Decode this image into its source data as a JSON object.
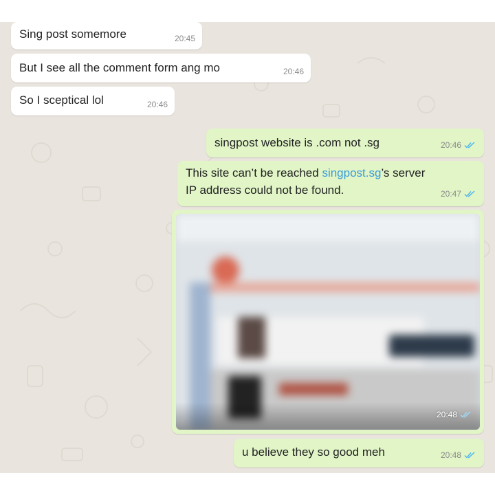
{
  "messages": {
    "m1": {
      "text": "Sing post somemore",
      "time": "20:45"
    },
    "m2": {
      "text": "But I see all the comment form ang mo",
      "time": "20:46"
    },
    "m3": {
      "text": "So I sceptical lol",
      "time": "20:46"
    },
    "m4": {
      "text": "singpost website is .com not .sg",
      "time": "20:46"
    },
    "m5": {
      "text_before": "This site can’t be reached ",
      "link": "singpost.sg",
      "text_after": "’s server",
      "line2": "IP address could not be found.",
      "time": "20:47"
    },
    "m6": {
      "time": "20:48"
    },
    "m7": {
      "text": "u believe they so good meh",
      "time": "20:48"
    }
  },
  "colors": {
    "chat_bg": "#e9e4dd",
    "incoming": "#ffffff",
    "outgoing": "#e1f5c7",
    "link": "#3a9bd8",
    "read_tick": "#4fb6ec"
  },
  "icons": {
    "read_receipt": "double-check-icon"
  }
}
